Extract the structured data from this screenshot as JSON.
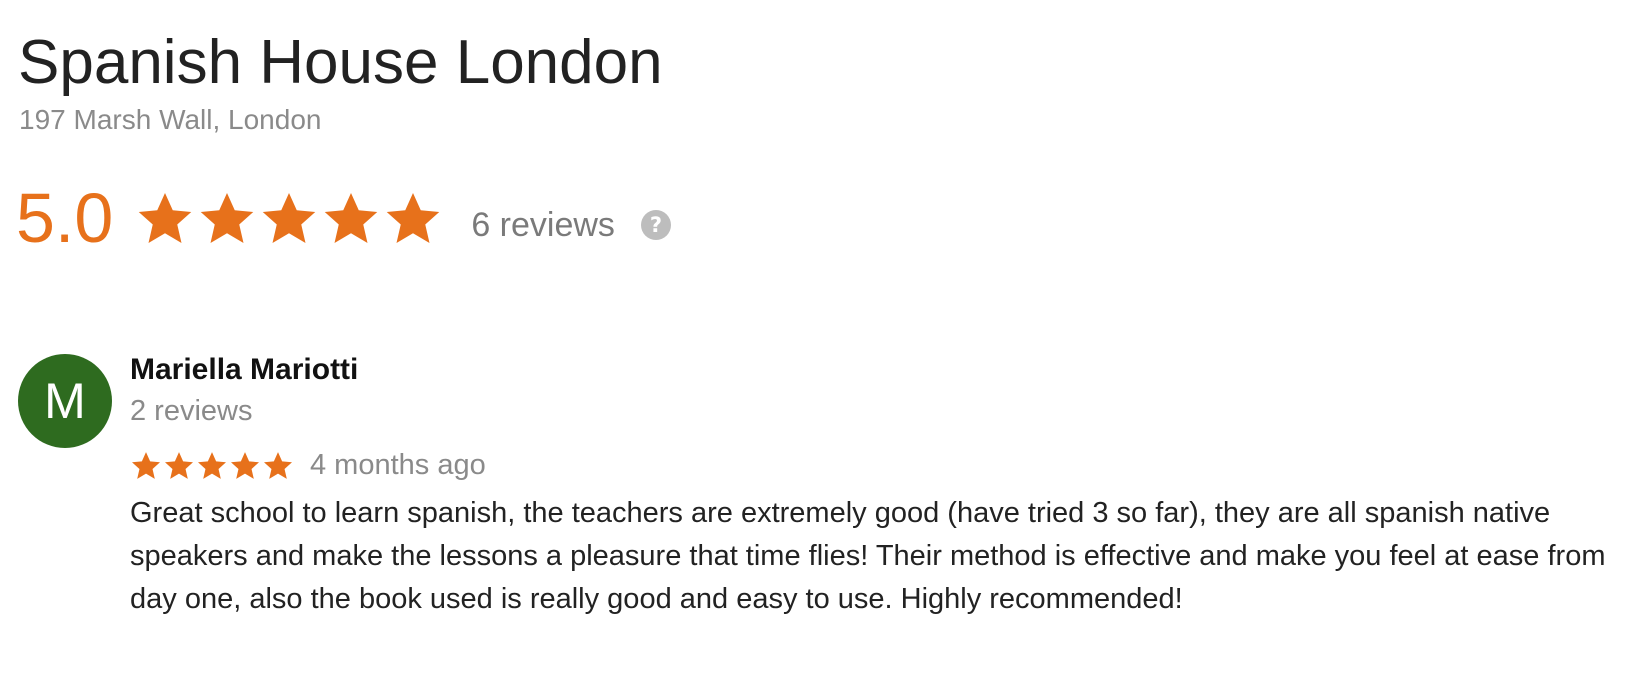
{
  "business": {
    "name": "Spanish House London",
    "address": "197 Marsh Wall, London"
  },
  "rating": {
    "value": "5.0",
    "stars": 5,
    "star_color": "#e7711b",
    "review_count_label": "6 reviews",
    "help_icon": "question-circle-icon",
    "help_glyph": "?"
  },
  "reviews": [
    {
      "avatar_letter": "M",
      "avatar_color": "#2e6b1f",
      "reviewer_name": "Mariella Mariotti",
      "reviewer_review_count": "2 reviews",
      "stars": 5,
      "time": "4 months ago",
      "text": "Great school to learn spanish, the teachers are extremely good (have tried 3 so far), they are all spanish native speakers and make the lessons a pleasure that time flies! Their method is effective and make you feel at ease from day one, also the book used is really good and easy to use. Highly recommended!"
    }
  ]
}
